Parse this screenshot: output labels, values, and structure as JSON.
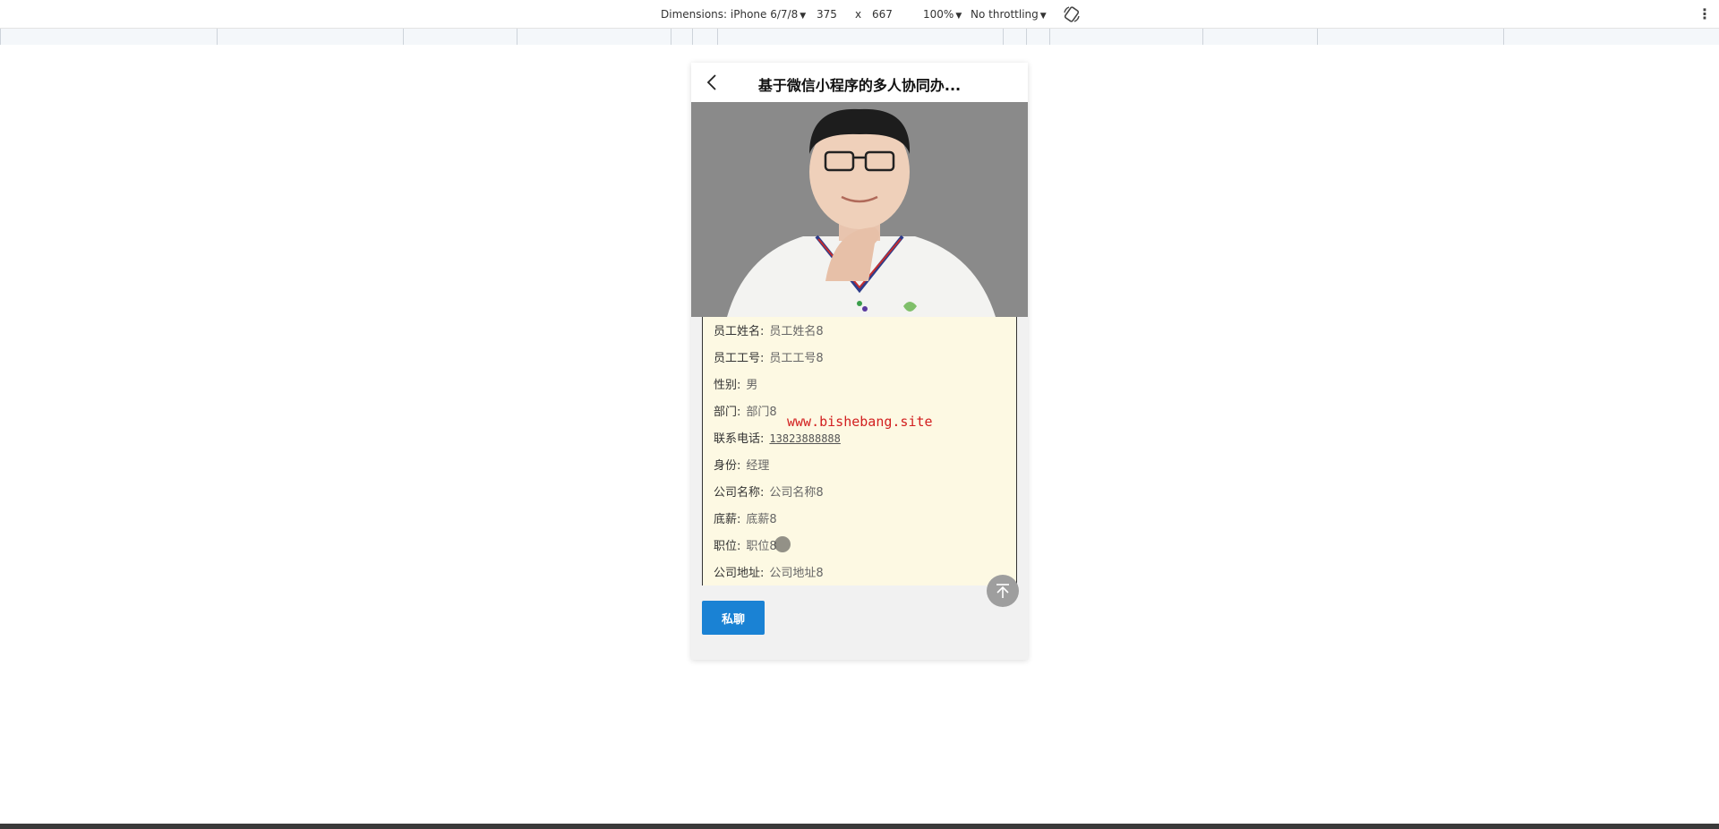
{
  "devtools": {
    "dimensions_label": "Dimensions: iPhone 6/7/8",
    "width": "375",
    "times": "x",
    "height": "667",
    "zoom": "100%",
    "throttling": "No throttling"
  },
  "navbar": {
    "title": "基于微信小程序的多人协同办..."
  },
  "details": [
    {
      "label": "员工姓名:",
      "value": "员工姓名8"
    },
    {
      "label": "员工工号:",
      "value": "员工工号8"
    },
    {
      "label": "性别:",
      "value": "男"
    },
    {
      "label": "部门:",
      "value": "部门8"
    },
    {
      "label": "联系电话:",
      "value": "13823888888"
    },
    {
      "label": "身份:",
      "value": "经理"
    },
    {
      "label": "公司名称:",
      "value": "公司名称8"
    },
    {
      "label": "底薪:",
      "value": "底薪8"
    },
    {
      "label": "职位:",
      "value": "职位8"
    },
    {
      "label": "公司地址:",
      "value": "公司地址8"
    }
  ],
  "watermark": "www.bishebang.site",
  "actions": {
    "chat_label": "私聊"
  },
  "colors": {
    "accent": "#1a82d4",
    "details_bg": "#fdf9e3",
    "watermark": "#d21f1f"
  },
  "icons": [
    "back-chevron-icon",
    "rotate-icon",
    "more-vert-icon",
    "scroll-to-top-icon"
  ]
}
